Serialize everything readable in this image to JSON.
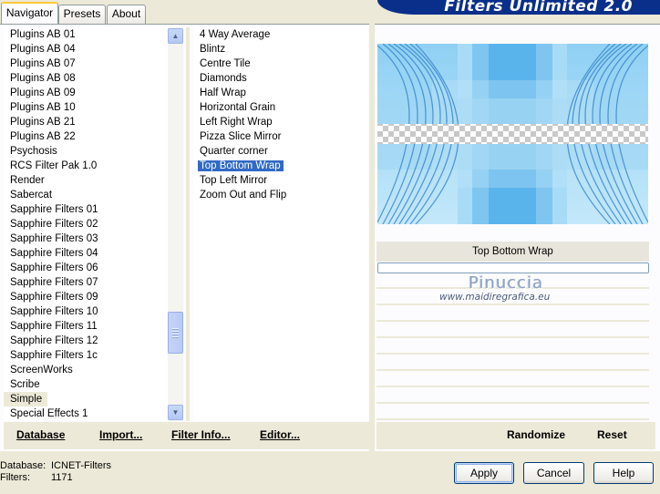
{
  "tabs": [
    {
      "label": "Navigator",
      "active": true
    },
    {
      "label": "Presets",
      "active": false
    },
    {
      "label": "About",
      "active": false
    }
  ],
  "app_title": "Filters Unlimited 2.0",
  "categories": [
    "Plugins AB 01",
    "Plugins AB 04",
    "Plugins AB 07",
    "Plugins AB 08",
    "Plugins AB 09",
    "Plugins AB 10",
    "Plugins AB 21",
    "Plugins AB 22",
    "Psychosis",
    "RCS Filter Pak 1.0",
    "Render",
    "Sabercat",
    "Sapphire Filters 01",
    "Sapphire Filters 02",
    "Sapphire Filters 03",
    "Sapphire Filters 04",
    "Sapphire Filters 06",
    "Sapphire Filters 07",
    "Sapphire Filters 09",
    "Sapphire Filters 10",
    "Sapphire Filters 11",
    "Sapphire Filters 12",
    "Sapphire Filters 1c",
    "ScreenWorks",
    "Scribe",
    "Simple",
    "Special Effects 1"
  ],
  "selected_category": "Simple",
  "filters": [
    "4 Way Average",
    "Blintz",
    "Centre Tile",
    "Diamonds",
    "Half Wrap",
    "Horizontal Grain",
    "Left Right Wrap",
    "Pizza Slice Mirror",
    "Quarter corner",
    "Top Bottom Wrap",
    "Top Left Mirror",
    "Zoom Out and Flip"
  ],
  "selected_filter": "Top Bottom Wrap",
  "preview": {
    "filter_name": "Top Bottom Wrap",
    "watermark_name": "Pinuccia",
    "watermark_url": "www.maidiregrafica.eu"
  },
  "toolbar": {
    "database": "Database",
    "import": "Import...",
    "filter_info": "Filter Info...",
    "editor": "Editor...",
    "randomize": "Randomize",
    "reset": "Reset"
  },
  "status": {
    "database_label": "Database:",
    "database_value": "ICNET-Filters",
    "filters_label": "Filters:",
    "filters_value": "1171"
  },
  "buttons": {
    "apply": "Apply",
    "cancel": "Cancel",
    "help": "Help"
  },
  "colors": {
    "selection": "#316ac5",
    "title_banner": "#0a2f8a",
    "preview_blue": "#4aa8e8"
  }
}
